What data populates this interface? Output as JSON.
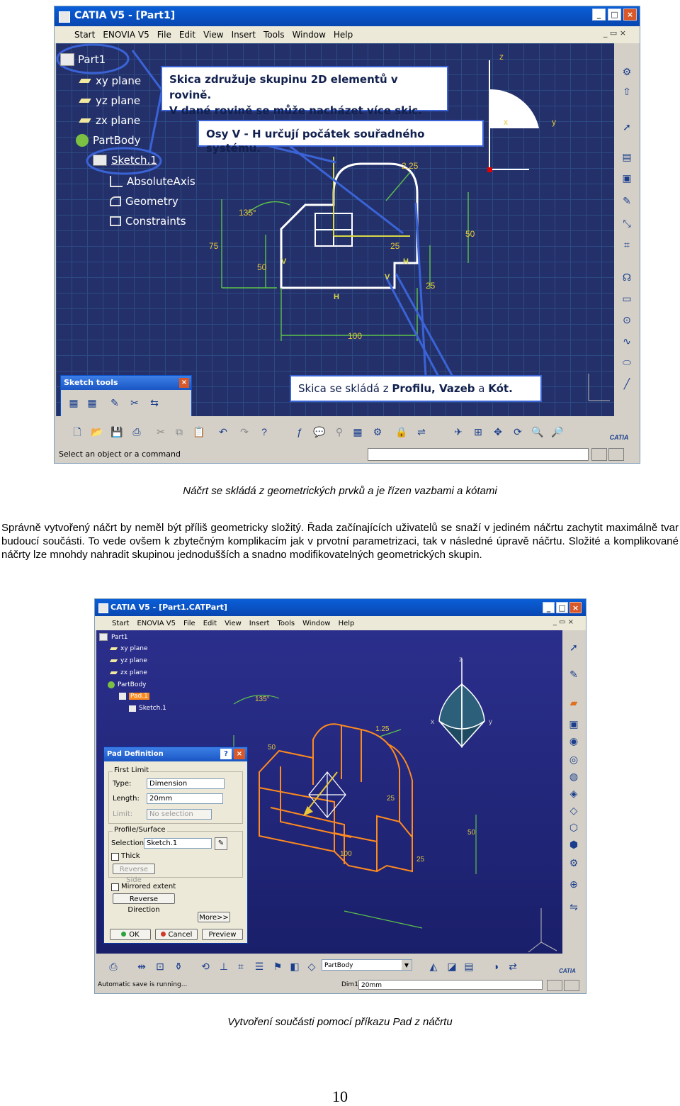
{
  "fig1": {
    "window_title": "CATIA V5 - [Part1]",
    "menu": [
      "Start",
      "ENOVIA V5",
      "File",
      "Edit",
      "View",
      "Insert",
      "Tools",
      "Window",
      "Help"
    ],
    "tree": {
      "root": "Part1",
      "items": [
        "xy plane",
        "yz plane",
        "zx plane",
        "PartBody"
      ],
      "sketch": "Sketch.1",
      "sketch_children": [
        "AbsoluteAxis",
        "Geometry",
        "Constraints"
      ]
    },
    "callouts": {
      "skica_line1": "Skica združuje skupinu 2D elementů v rovině.",
      "skica_line2": "V dané rovině se může nacházet více skic.",
      "osy": "Osy V - H určují počátek souřadného systému.",
      "sklada_prefix": "Skica se skládá z ",
      "sklada_profil": "Profilu, Vazeb",
      "sklada_a": " a ",
      "sklada_kot": "Kót."
    },
    "dimensions": {
      "d135": "135°",
      "d75": "75",
      "d50a": "50",
      "d100": "100",
      "d25a": "25",
      "d25b": "25",
      "d50b": "50",
      "r225": "2.25"
    },
    "constraint_labels": {
      "v": "V",
      "h": "H"
    },
    "axis_labels": {
      "z": "z",
      "x": "x",
      "y": "y"
    },
    "sketch_tools": {
      "title": "Sketch tools"
    },
    "status": "Select an object or a command",
    "brand": "CATIA"
  },
  "caption1": "Náčrt se skládá z geometrických prvků a je řízen vazbami a kótami",
  "paragraph": "Správně vytvořený náčrt by neměl být příliš geometricky složitý. Řada začínajících uživatelů se snaží v jediném náčrtu zachytit maximálně tvar budoucí součásti. To vede ovšem k zbytečným komplikacím jak v prvotní parametrizaci, tak v následné úpravě náčrtu. Složité a komplikované náčrty lze mnohdy nahradit skupinou jednodušších a snadno modifikovatelných geometrických skupin.",
  "fig2": {
    "window_title": "CATIA V5 - [Part1.CATPart]",
    "menu": [
      "Start",
      "ENOVIA V5",
      "File",
      "Edit",
      "View",
      "Insert",
      "Tools",
      "Window",
      "Help"
    ],
    "tree": {
      "root": "Part1",
      "items": [
        "xy plane",
        "yz plane",
        "zx plane",
        "PartBody"
      ],
      "pad": "Pad.1",
      "sketch": "Sketch.1"
    },
    "dialog": {
      "title": "Pad Definition",
      "first_limit": "First Limit",
      "type_label": "Type:",
      "type_value": "Dimension",
      "length_label": "Length:",
      "length_value": "20mm",
      "limit_label": "Limit:",
      "limit_value": "No selection",
      "profile_group": "Profile/Surface",
      "selection_label": "Selection:",
      "selection_value": "Sketch.1",
      "thick": "Thick",
      "reverse_side": "Reverse Side",
      "mirrored": "Mirrored extent",
      "reverse_dir": "Reverse Direction",
      "more": "More>>",
      "ok": "OK",
      "cancel": "Cancel",
      "preview": "Preview"
    },
    "dimensions": {
      "d135": "135°",
      "d50a": "50",
      "d125": "1.25",
      "d25a": "25",
      "d25b": "25",
      "d50b": "50",
      "d100": "100"
    },
    "axis_labels": {
      "z": "z",
      "x": "x",
      "y": "y"
    },
    "combo": "PartBody",
    "status": "Automatic save is running...",
    "dim_label": "Dim1",
    "dim_value": "20mm",
    "brand": "CATIA"
  },
  "caption2": "Vytvoření součásti pomocí příkazu Pad z náčrtu",
  "page_number": "10",
  "colors": {
    "canvas": "#24306a",
    "callout_border": "#3a63d6",
    "pad_orange": "#ff8a1e",
    "sketch_white": "#ffffff",
    "constraint_green": "#c8d84a"
  }
}
